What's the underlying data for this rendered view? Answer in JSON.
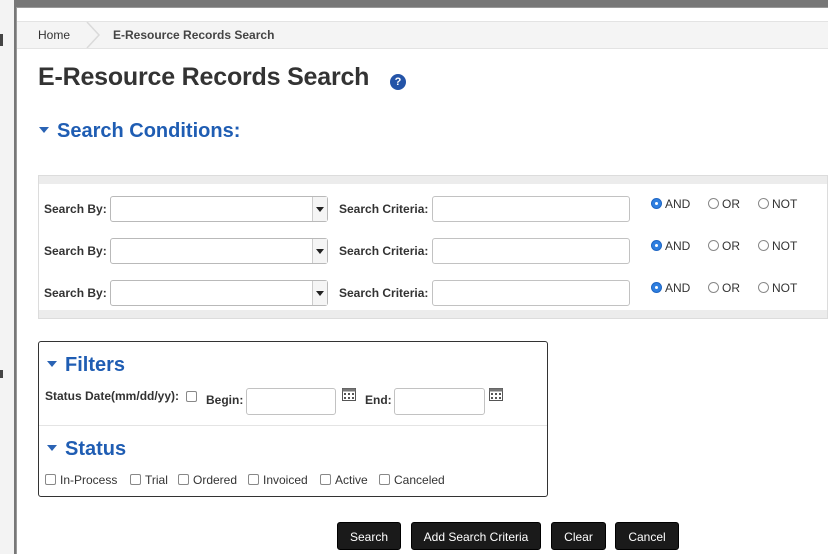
{
  "breadcrumb": {
    "home": "Home",
    "current": "E-Resource Records Search"
  },
  "page_title": "E-Resource Records Search",
  "help_icon": "?",
  "search_conditions": {
    "heading": "Search Conditions:",
    "search_by_label": "Search By:",
    "criteria_label": "Search Criteria:",
    "operators": [
      "AND",
      "OR",
      "NOT"
    ],
    "rows": [
      {
        "search_by": "",
        "criteria": "",
        "selected_operator": "AND"
      },
      {
        "search_by": "",
        "criteria": "",
        "selected_operator": "AND"
      },
      {
        "search_by": "",
        "criteria": "",
        "selected_operator": "AND"
      }
    ]
  },
  "filters": {
    "heading": "Filters",
    "status_date_label": "Status Date(mm/dd/yy):",
    "begin_label": "Begin:",
    "end_label": "End:",
    "begin_value": "",
    "end_value": ""
  },
  "status": {
    "heading": "Status",
    "options": [
      "In-Process",
      "Trial",
      "Ordered",
      "Invoiced",
      "Active",
      "Canceled"
    ]
  },
  "buttons": {
    "search": "Search",
    "add_criteria": "Add Search Criteria",
    "clear": "Clear",
    "cancel": "Cancel"
  },
  "colors": {
    "accent": "#1f5db3",
    "button_bg": "#1a1a1a",
    "radio_selected": "#2f7fe0"
  }
}
